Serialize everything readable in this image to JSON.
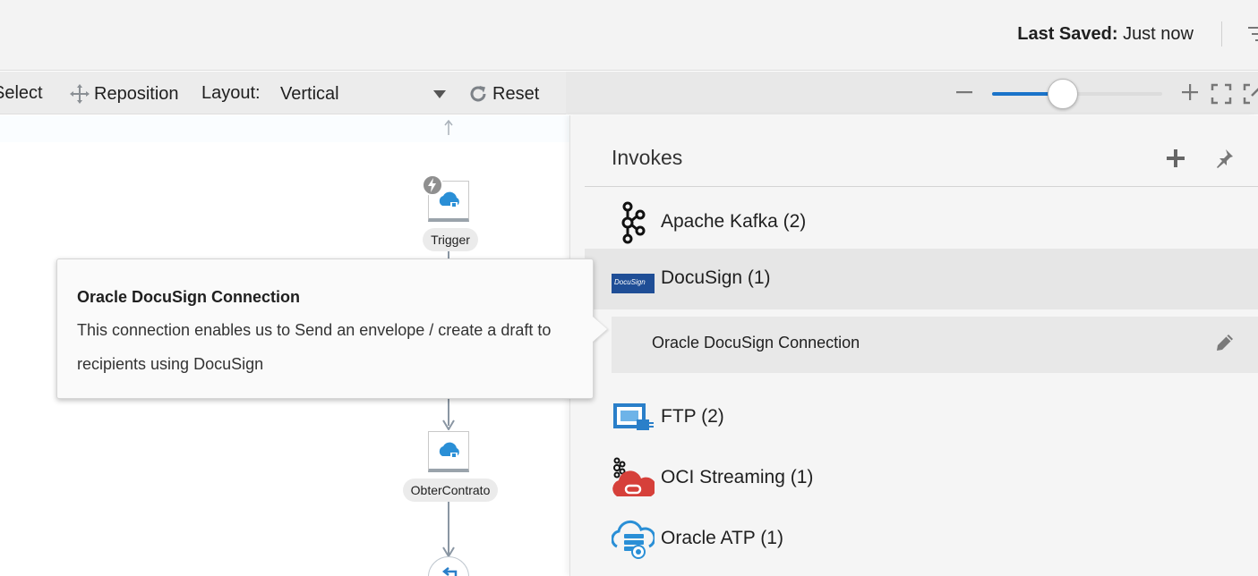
{
  "header": {
    "last_saved_label": "Last Saved:",
    "last_saved_value": "Just now",
    "menu_icon": "hamburger-lines-icon"
  },
  "toolbar": {
    "select_label": "Select",
    "reposition_label": "Reposition",
    "layout_label": "Layout:",
    "layout_value": "Vertical",
    "reset_label": "Reset",
    "zoom_level": 0.42
  },
  "canvas": {
    "nodes": [
      {
        "label": "Trigger",
        "icon": "cloud-connection-icon"
      },
      {
        "label": "ObterContrato",
        "icon": "cloud-connection-icon"
      }
    ]
  },
  "panel": {
    "title": "Invokes",
    "categories": [
      {
        "label": "Apache Kafka (2)",
        "icon": "kafka-icon"
      },
      {
        "label": "DocuSign (1)",
        "icon": "docusign-logo-icon",
        "logo_text": "DocuSign"
      },
      {
        "label": "FTP (2)",
        "icon": "ftp-icon"
      },
      {
        "label": "OCI Streaming (1)",
        "icon": "oci-streaming-icon"
      },
      {
        "label": "Oracle ATP (1)",
        "icon": "oracle-atp-icon"
      }
    ],
    "connection": {
      "label": "Oracle DocuSign Connection"
    }
  },
  "tooltip": {
    "title": "Oracle DocuSign Connection",
    "body": "This connection enables us to Send an envelope / create a draft to recipients using DocuSign"
  },
  "colors": {
    "accent": "#1a73c9",
    "docusign_bg": "#1f4e96",
    "ftp_blue": "#2a7fc9",
    "oci_red": "#d6403a"
  }
}
